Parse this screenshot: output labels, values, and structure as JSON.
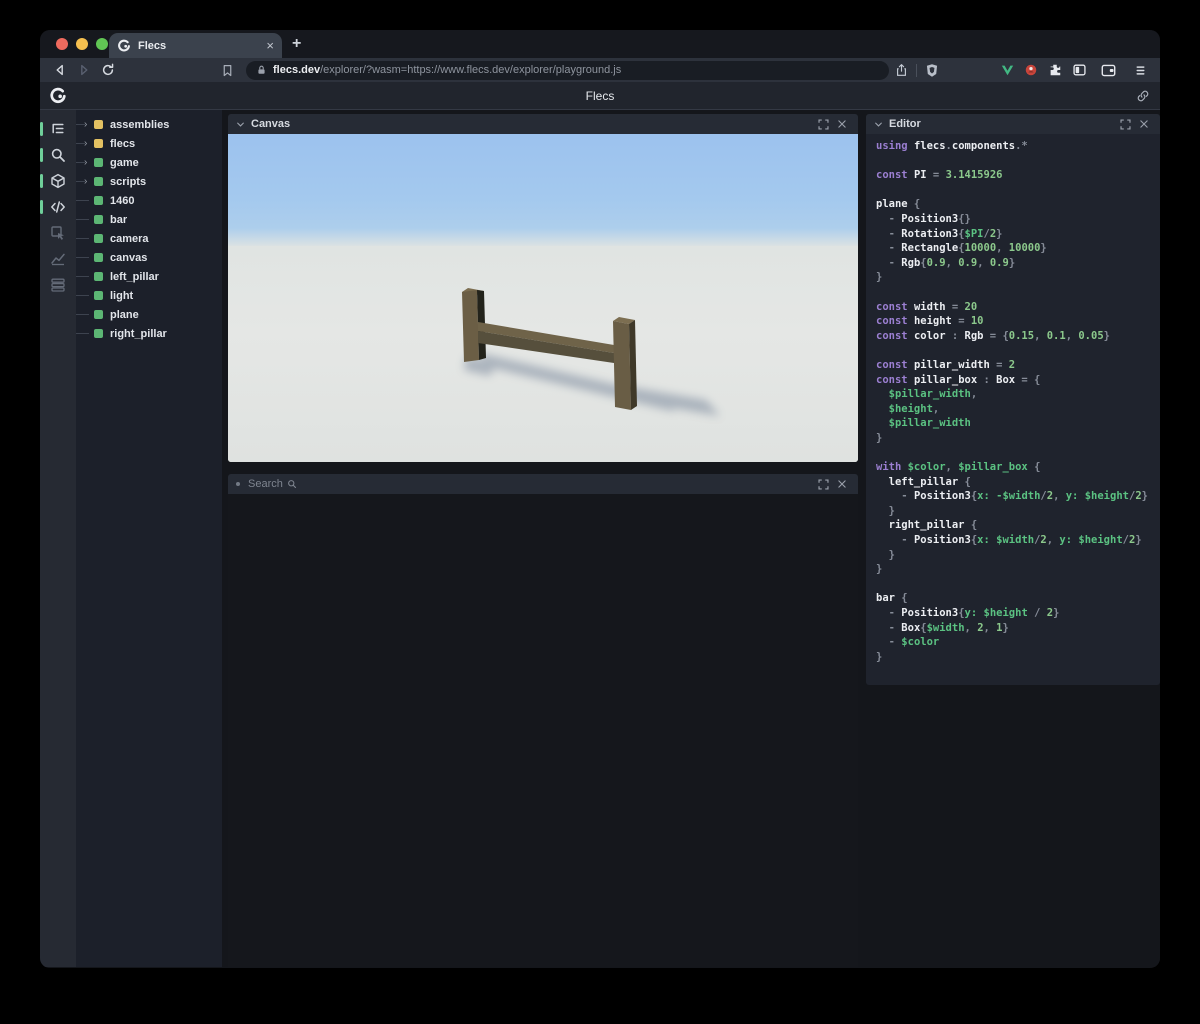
{
  "browser": {
    "tab_title": "Flecs",
    "new_tab_label": "+",
    "tab_close_label": "×",
    "url_domain": "flecs.dev",
    "url_rest": "/explorer/?wasm=https://www.flecs.dev/explorer/playground.js",
    "traffic_lights": {
      "close": "#ee6a5e",
      "minimize": "#f5bf4f",
      "zoom": "#61c554"
    },
    "extension_colors": {
      "vue_green": "#42b883",
      "red_badge": "#c8453b"
    }
  },
  "app": {
    "title": "Flecs"
  },
  "activity_bar": [
    {
      "id": "entity-tree",
      "active": true
    },
    {
      "id": "search",
      "active": true
    },
    {
      "id": "scene",
      "active": true
    },
    {
      "id": "code",
      "active": true
    },
    {
      "id": "inspect",
      "active": false
    },
    {
      "id": "stats",
      "active": false
    },
    {
      "id": "tables",
      "active": false
    }
  ],
  "tree": {
    "items": [
      {
        "label": "assemblies",
        "color": "#e3c162",
        "expandable": true
      },
      {
        "label": "flecs",
        "color": "#e3c162",
        "expandable": true
      },
      {
        "label": "game",
        "color": "#5cb674",
        "expandable": true
      },
      {
        "label": "scripts",
        "color": "#5cb674",
        "expandable": true
      },
      {
        "label": "1460",
        "color": "#5cb674",
        "expandable": false
      },
      {
        "label": "bar",
        "color": "#5cb674",
        "expandable": false
      },
      {
        "label": "camera",
        "color": "#5cb674",
        "expandable": false
      },
      {
        "label": "canvas",
        "color": "#5cb674",
        "expandable": false
      },
      {
        "label": "left_pillar",
        "color": "#5cb674",
        "expandable": false
      },
      {
        "label": "light",
        "color": "#5cb674",
        "expandable": false
      },
      {
        "label": "plane",
        "color": "#5cb674",
        "expandable": false
      },
      {
        "label": "right_pillar",
        "color": "#5cb674",
        "expandable": false
      }
    ]
  },
  "canvas_panel": {
    "title": "Canvas"
  },
  "search_panel": {
    "title": "Search",
    "placeholder": "Search"
  },
  "editor_panel": {
    "title": "Editor",
    "syntax_colors": {
      "keyword": "#9b7fd1",
      "identifier": "#eceef2",
      "punctuation": "#878d99",
      "number": "#8cc98c",
      "variable": "#5bc282"
    },
    "code_lines": [
      [
        [
          "kw",
          "using "
        ],
        [
          "id",
          "flecs"
        ],
        [
          "pu",
          "."
        ],
        [
          "id",
          "components"
        ],
        [
          "pu",
          ".*"
        ]
      ],
      [],
      [
        [
          "kw",
          "const "
        ],
        [
          "id",
          "PI"
        ],
        [
          "pu",
          " = "
        ],
        [
          "nu",
          "3.1415926"
        ]
      ],
      [],
      [
        [
          "id",
          "plane"
        ],
        [
          "pu",
          " {"
        ]
      ],
      [
        [
          "pu",
          "  - "
        ],
        [
          "id",
          "Position3"
        ],
        [
          "pu",
          "{}"
        ]
      ],
      [
        [
          "pu",
          "  - "
        ],
        [
          "id",
          "Rotation3"
        ],
        [
          "pu",
          "{"
        ],
        [
          "va",
          "$PI"
        ],
        [
          "pu",
          "/"
        ],
        [
          "nu",
          "2"
        ],
        [
          "pu",
          "}"
        ]
      ],
      [
        [
          "pu",
          "  - "
        ],
        [
          "id",
          "Rectangle"
        ],
        [
          "pu",
          "{"
        ],
        [
          "nu",
          "10000"
        ],
        [
          "pu",
          ", "
        ],
        [
          "nu",
          "10000"
        ],
        [
          "pu",
          "}"
        ]
      ],
      [
        [
          "pu",
          "  - "
        ],
        [
          "id",
          "Rgb"
        ],
        [
          "pu",
          "{"
        ],
        [
          "nu",
          "0.9"
        ],
        [
          "pu",
          ", "
        ],
        [
          "nu",
          "0.9"
        ],
        [
          "pu",
          ", "
        ],
        [
          "nu",
          "0.9"
        ],
        [
          "pu",
          "}"
        ]
      ],
      [
        [
          "pu",
          "}"
        ]
      ],
      [],
      [
        [
          "kw",
          "const "
        ],
        [
          "id",
          "width"
        ],
        [
          "pu",
          " = "
        ],
        [
          "nu",
          "20"
        ]
      ],
      [
        [
          "kw",
          "const "
        ],
        [
          "id",
          "height"
        ],
        [
          "pu",
          " = "
        ],
        [
          "nu",
          "10"
        ]
      ],
      [
        [
          "kw",
          "const "
        ],
        [
          "id",
          "color"
        ],
        [
          "pu",
          " : "
        ],
        [
          "id",
          "Rgb"
        ],
        [
          "pu",
          " = {"
        ],
        [
          "nu",
          "0.15"
        ],
        [
          "pu",
          ", "
        ],
        [
          "nu",
          "0.1"
        ],
        [
          "pu",
          ", "
        ],
        [
          "nu",
          "0.05"
        ],
        [
          "pu",
          "}"
        ]
      ],
      [],
      [
        [
          "kw",
          "const "
        ],
        [
          "id",
          "pillar_width"
        ],
        [
          "pu",
          " = "
        ],
        [
          "nu",
          "2"
        ]
      ],
      [
        [
          "kw",
          "const "
        ],
        [
          "id",
          "pillar_box"
        ],
        [
          "pu",
          " : "
        ],
        [
          "id",
          "Box"
        ],
        [
          "pu",
          " = {"
        ]
      ],
      [
        [
          "va",
          "  $pillar_width"
        ],
        [
          "pu",
          ","
        ]
      ],
      [
        [
          "va",
          "  $height"
        ],
        [
          "pu",
          ","
        ]
      ],
      [
        [
          "va",
          "  $pillar_width"
        ]
      ],
      [
        [
          "pu",
          "}"
        ]
      ],
      [],
      [
        [
          "kw",
          "with "
        ],
        [
          "va",
          "$color"
        ],
        [
          "pu",
          ", "
        ],
        [
          "va",
          "$pillar_box"
        ],
        [
          "pu",
          " {"
        ]
      ],
      [
        [
          "id",
          "  left_pillar"
        ],
        [
          "pu",
          " {"
        ]
      ],
      [
        [
          "pu",
          "    - "
        ],
        [
          "id",
          "Position3"
        ],
        [
          "pu",
          "{"
        ],
        [
          "va",
          "x:"
        ],
        [
          "pu",
          " "
        ],
        [
          "va",
          "-$width"
        ],
        [
          "pu",
          "/"
        ],
        [
          "nu",
          "2"
        ],
        [
          "pu",
          ", "
        ],
        [
          "va",
          "y:"
        ],
        [
          "pu",
          " "
        ],
        [
          "va",
          "$height"
        ],
        [
          "pu",
          "/"
        ],
        [
          "nu",
          "2"
        ],
        [
          "pu",
          "}"
        ]
      ],
      [
        [
          "pu",
          "  }"
        ]
      ],
      [
        [
          "id",
          "  right_pillar"
        ],
        [
          "pu",
          " {"
        ]
      ],
      [
        [
          "pu",
          "    - "
        ],
        [
          "id",
          "Position3"
        ],
        [
          "pu",
          "{"
        ],
        [
          "va",
          "x:"
        ],
        [
          "pu",
          " "
        ],
        [
          "va",
          "$width"
        ],
        [
          "pu",
          "/"
        ],
        [
          "nu",
          "2"
        ],
        [
          "pu",
          ", "
        ],
        [
          "va",
          "y:"
        ],
        [
          "pu",
          " "
        ],
        [
          "va",
          "$height"
        ],
        [
          "pu",
          "/"
        ],
        [
          "nu",
          "2"
        ],
        [
          "pu",
          "}"
        ]
      ],
      [
        [
          "pu",
          "  }"
        ]
      ],
      [
        [
          "pu",
          "}"
        ]
      ],
      [],
      [
        [
          "id",
          "bar"
        ],
        [
          "pu",
          " {"
        ]
      ],
      [
        [
          "pu",
          "  - "
        ],
        [
          "id",
          "Position3"
        ],
        [
          "pu",
          "{"
        ],
        [
          "va",
          "y:"
        ],
        [
          "pu",
          " "
        ],
        [
          "va",
          "$height"
        ],
        [
          "pu",
          " / "
        ],
        [
          "nu",
          "2"
        ],
        [
          "pu",
          "}"
        ]
      ],
      [
        [
          "pu",
          "  - "
        ],
        [
          "id",
          "Box"
        ],
        [
          "pu",
          "{"
        ],
        [
          "va",
          "$width"
        ],
        [
          "pu",
          ", "
        ],
        [
          "nu",
          "2"
        ],
        [
          "pu",
          ", "
        ],
        [
          "nu",
          "1"
        ],
        [
          "pu",
          "}"
        ]
      ],
      [
        [
          "pu",
          "  - "
        ],
        [
          "va",
          "$color"
        ]
      ],
      [
        [
          "pu",
          "}"
        ]
      ]
    ]
  },
  "scene": {
    "sky_color": "#9cc2ee",
    "ground_color": "#e3e6e4",
    "pillar_front_color": "#6b5e45",
    "bar_top_color": "#6f6349",
    "shadow_color": "#5f7089"
  }
}
